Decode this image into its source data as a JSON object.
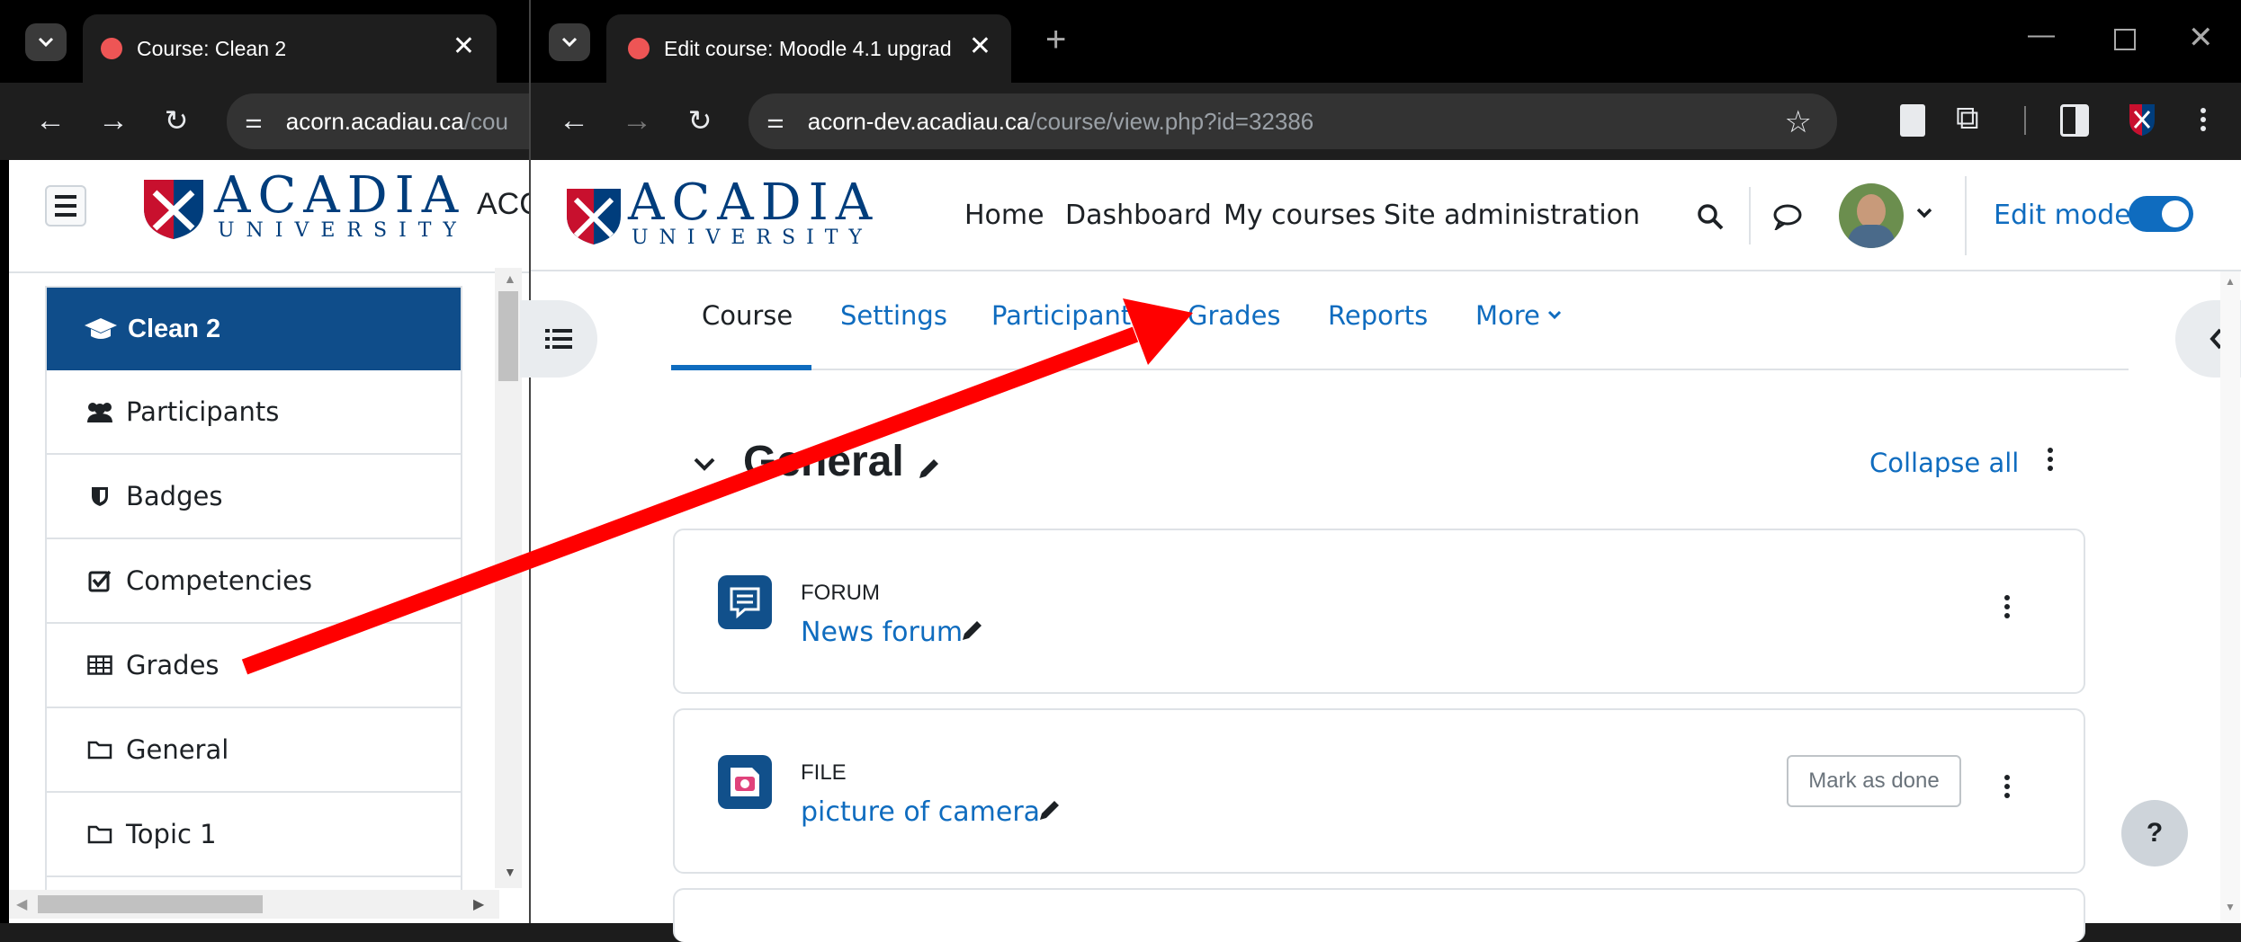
{
  "back_window": {
    "tab_title": "Course: Clean 2",
    "url_host": "acorn.acadiau.ca",
    "url_path": "/cou",
    "header_text": "ACC",
    "course_name": "Clean 2",
    "nav_items": [
      {
        "label": "Participants",
        "icon": "users-icon"
      },
      {
        "label": "Badges",
        "icon": "shield-icon"
      },
      {
        "label": "Competencies",
        "icon": "checkbox-icon"
      },
      {
        "label": "Grades",
        "icon": "table-icon"
      },
      {
        "label": "General",
        "icon": "folder-icon"
      },
      {
        "label": "Topic 1",
        "icon": "folder-icon"
      }
    ]
  },
  "front_window": {
    "tab_title": "Edit course: Moodle 4.1 upgrad",
    "url_host": "acorn-dev.acadiau.ca",
    "url_path": "/course/view.php?id=32386",
    "logo": {
      "main": "ACADIA",
      "sub": "UNIVERSITY"
    },
    "primary_nav": [
      "Home",
      "Dashboard",
      "My courses",
      "Site administration"
    ],
    "edit_mode_label": "Edit mode",
    "edit_mode_on": true,
    "secondary_nav": [
      "Course",
      "Settings",
      "Participants",
      "Grades",
      "Reports",
      "More"
    ],
    "active_tab": "Course",
    "section_title": "General",
    "collapse_all": "Collapse all",
    "activities": [
      {
        "type": "FORUM",
        "name": "News forum",
        "icon": "forum-icon",
        "action": ""
      },
      {
        "type": "FILE",
        "name": "picture of camera",
        "icon": "image-file-icon",
        "action": "Mark as done"
      }
    ],
    "help_label": "?"
  },
  "colors": {
    "moodle_blue": "#0f6cbf",
    "acadia_navy": "#003d7c",
    "arrow_red": "#ff0000",
    "chrome_dark": "#1e1e1e"
  }
}
